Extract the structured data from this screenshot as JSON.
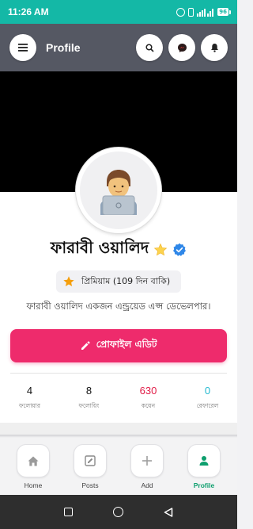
{
  "status_bar": {
    "time": "11:26 AM",
    "battery": "96"
  },
  "app_bar": {
    "title": "Profile"
  },
  "profile": {
    "name": "ফারাবী ওয়ালিদ",
    "premium_text": "প্রিমিয়াম (109 দিন বাকি)",
    "bio": "ফারাবী ওয়ালিদ একজন এন্ড্রয়েড এপ্স ডেভেলপার।",
    "edit_label": "প্রোফাইল এডিট"
  },
  "stats": [
    {
      "value": "4",
      "label": "ফলোয়ার",
      "color": "#111111"
    },
    {
      "value": "8",
      "label": "ফলোয়িং",
      "color": "#111111"
    },
    {
      "value": "630",
      "label": "কয়েন",
      "color": "#e11d48"
    },
    {
      "value": "0",
      "label": "রেফারেল",
      "color": "#22b8cf"
    }
  ],
  "bottom_nav": [
    {
      "label": "Home",
      "icon": "home-icon",
      "active": false
    },
    {
      "label": "Posts",
      "icon": "posts-icon",
      "active": false
    },
    {
      "label": "Add",
      "icon": "add-icon",
      "active": false
    },
    {
      "label": "Profile",
      "icon": "person-icon",
      "active": true
    }
  ],
  "colors": {
    "accent": "#14b8a6",
    "app_bar": "#555863",
    "edit_button": "#ee2b6c",
    "nav_active": "#0e9f6e"
  }
}
